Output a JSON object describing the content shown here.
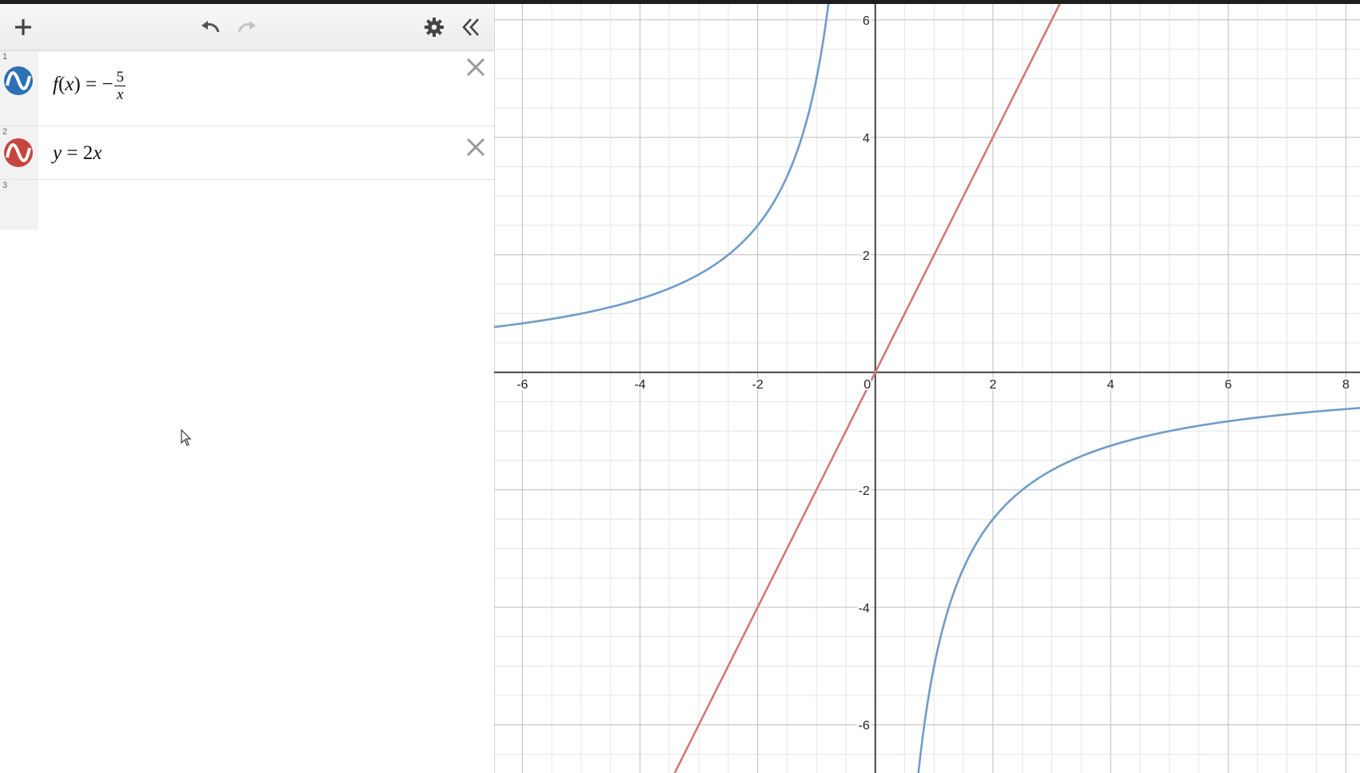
{
  "toolbar": {
    "add_icon": "plus-icon",
    "undo_icon": "undo-icon",
    "redo_icon": "redo-icon",
    "settings_icon": "gear-icon",
    "collapse_icon": "double-chevron-left-icon"
  },
  "expressions": [
    {
      "index": "1",
      "lhs": "f",
      "arg": "x",
      "equals": "=",
      "sign": "−",
      "numerator": "5",
      "denominator": "x",
      "color": "#2d70b3"
    },
    {
      "index": "2",
      "text_y": "y",
      "equals": "=",
      "coef": "2",
      "var": "x",
      "color": "#c74440"
    },
    {
      "index": "3"
    }
  ],
  "graph": {
    "x_ticks": [
      "-6",
      "-4",
      "-2",
      "0",
      "2",
      "4",
      "6",
      "8"
    ],
    "y_ticks": [
      "6",
      "4",
      "2",
      "-2",
      "-4",
      "-6"
    ],
    "x_range": [
      -6.48,
      8.24
    ],
    "y_range": [
      -6.82,
      6.27
    ],
    "curve_colors": {
      "f": "#6f9cca",
      "line": "#d07a74"
    }
  }
}
